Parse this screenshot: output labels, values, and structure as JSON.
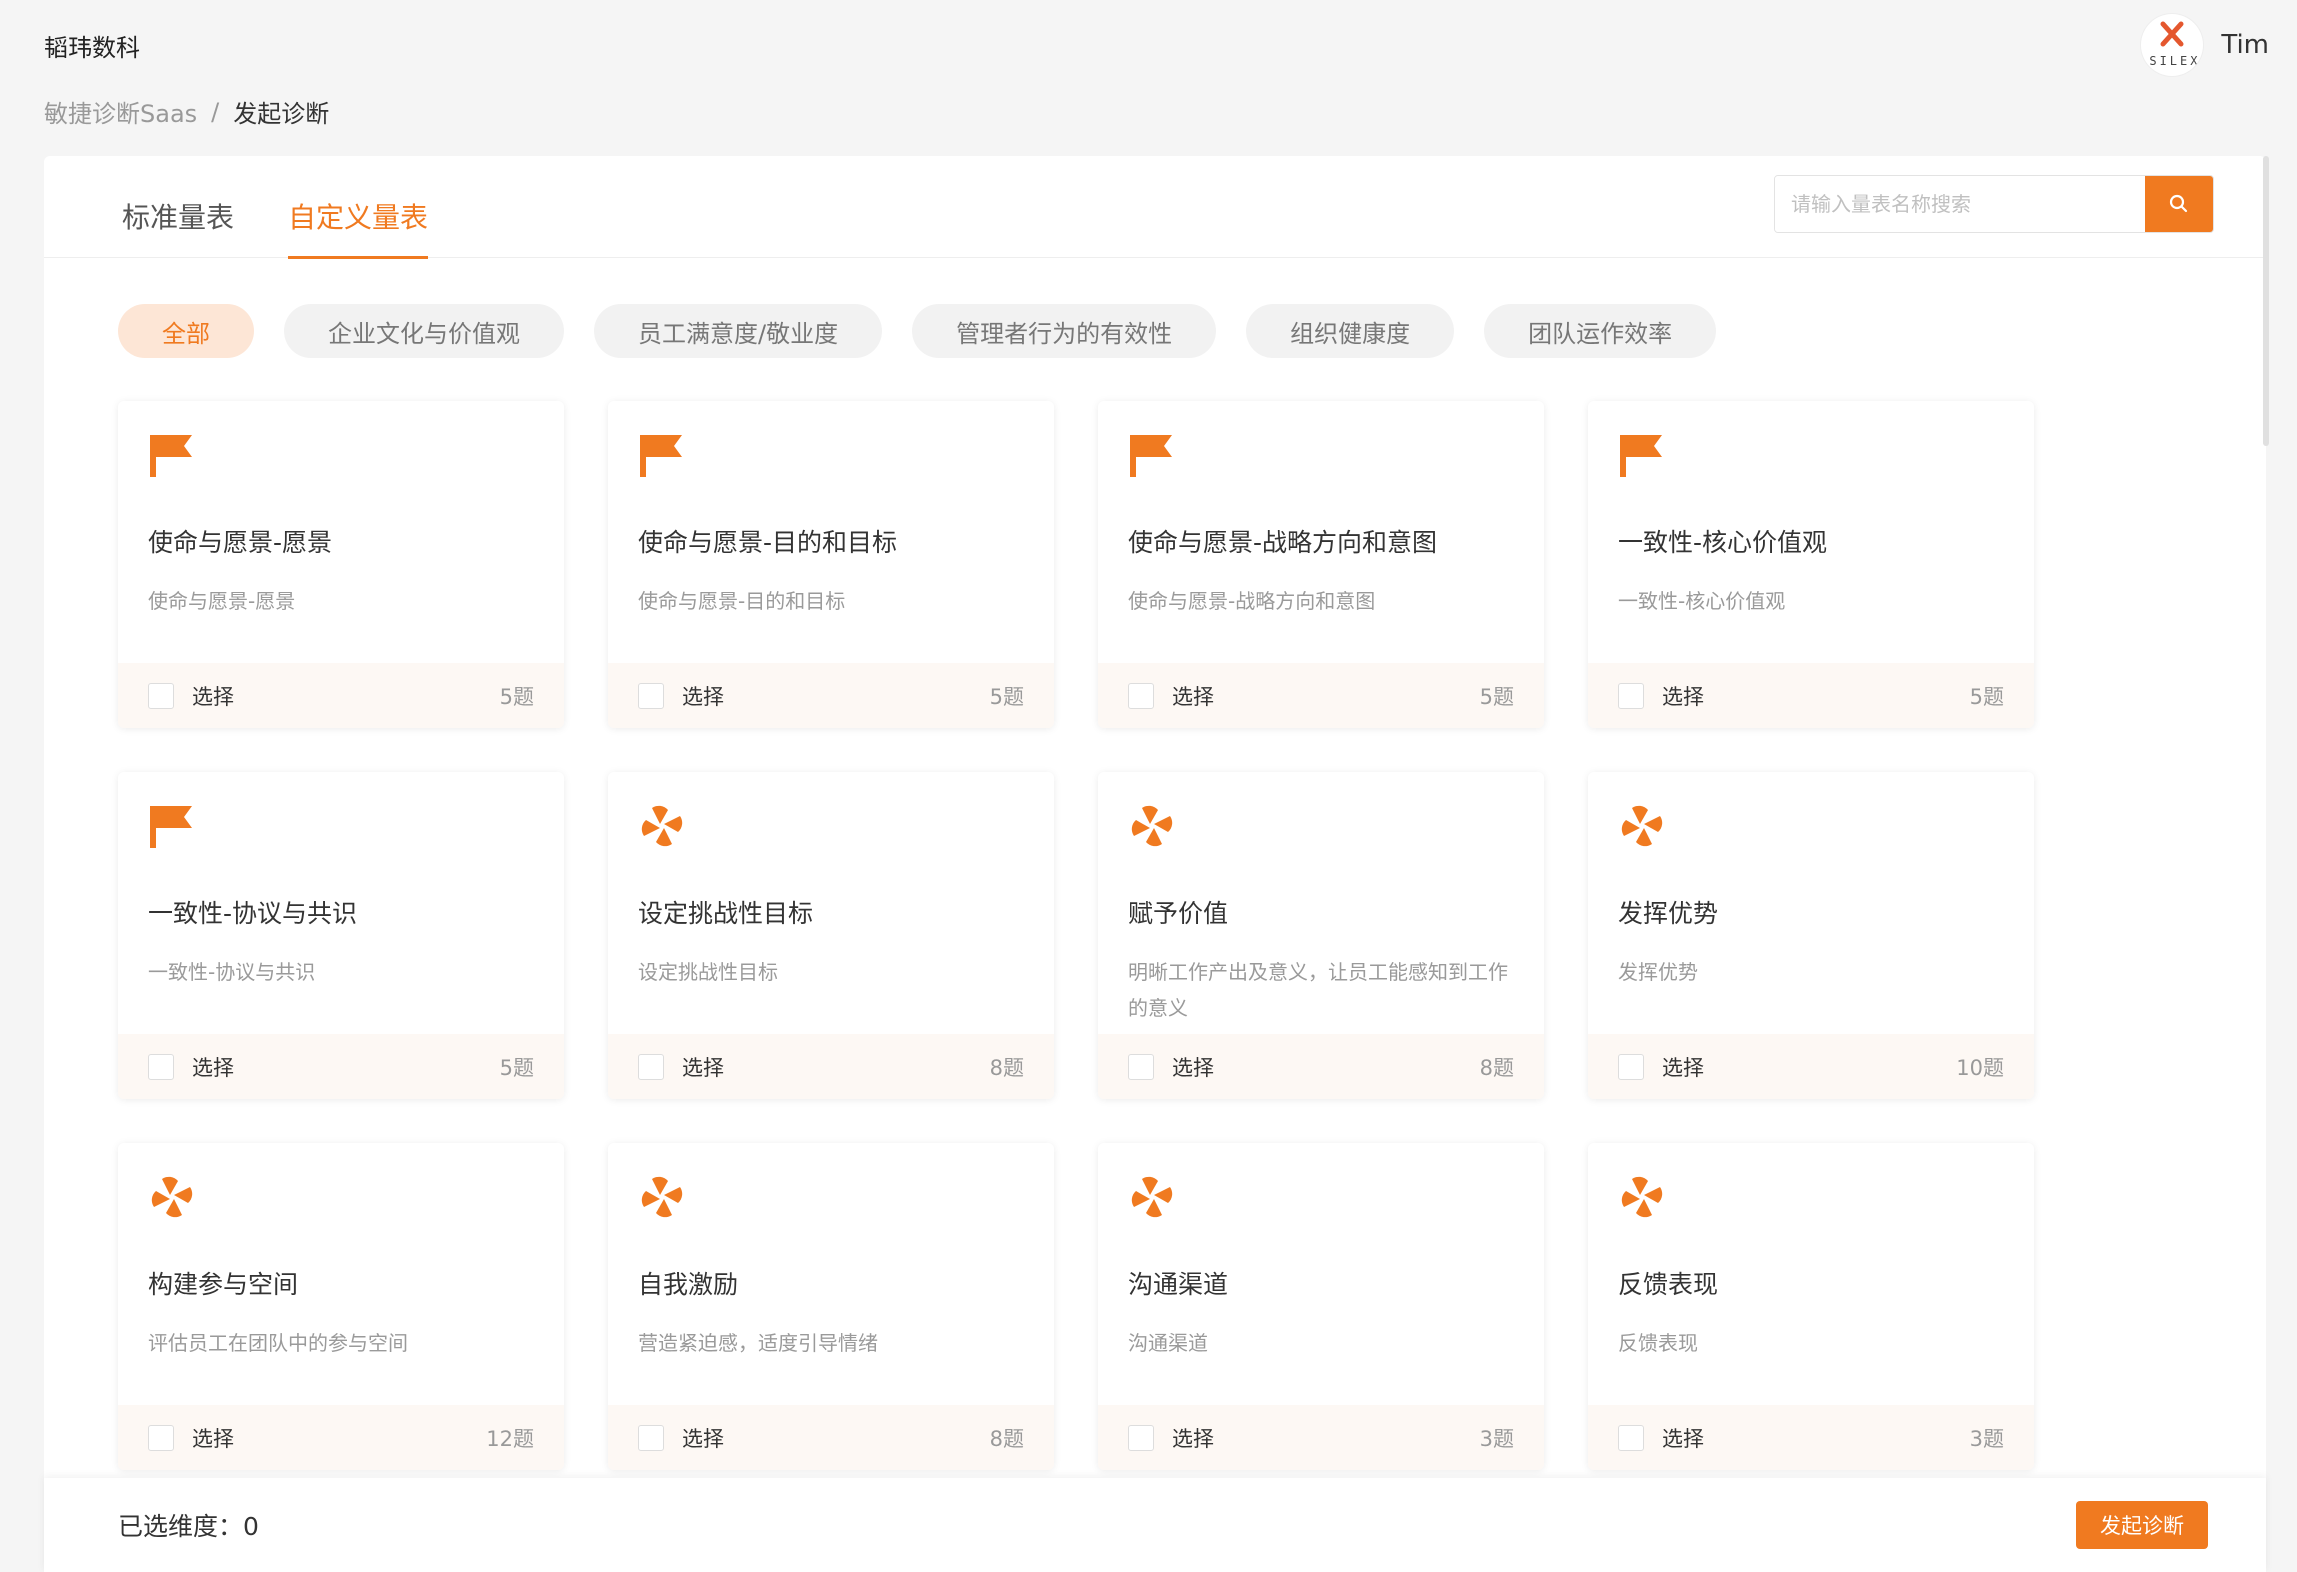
{
  "header": {
    "brand": "韬玮数科",
    "user_name": "Tim",
    "avatar_text": "SILEX"
  },
  "breadcrumb": {
    "parent": "敏捷诊断Saas",
    "separator": "/",
    "current": "发起诊断"
  },
  "tabs": [
    {
      "label": "标准量表",
      "active": false
    },
    {
      "label": "自定义量表",
      "active": true
    }
  ],
  "search": {
    "placeholder": "请输入量表名称搜索",
    "value": ""
  },
  "categories": [
    {
      "label": "全部",
      "active": true
    },
    {
      "label": "企业文化与价值观",
      "active": false
    },
    {
      "label": "员工满意度/敬业度",
      "active": false
    },
    {
      "label": "管理者行为的有效性",
      "active": false
    },
    {
      "label": "组织健康度",
      "active": false
    },
    {
      "label": "团队运作效率",
      "active": false
    }
  ],
  "select_label": "选择",
  "cards": [
    {
      "icon": "flag-icon",
      "title": "使命与愿景-愿景",
      "desc": "使命与愿景-愿景",
      "count": "5题"
    },
    {
      "icon": "flag-icon",
      "title": "使命与愿景-目的和目标",
      "desc": "使命与愿景-目的和目标",
      "count": "5题"
    },
    {
      "icon": "flag-icon",
      "title": "使命与愿景-战略方向和意图",
      "desc": "使命与愿景-战略方向和意图",
      "count": "5题"
    },
    {
      "icon": "flag-icon",
      "title": "一致性-核心价值观",
      "desc": "一致性-核心价值观",
      "count": "5题"
    },
    {
      "icon": "flag-icon",
      "title": "一致性-协议与共识",
      "desc": "一致性-协议与共识",
      "count": "5题"
    },
    {
      "icon": "pinwheel-icon",
      "title": "设定挑战性目标",
      "desc": "设定挑战性目标",
      "count": "8题"
    },
    {
      "icon": "pinwheel-icon",
      "title": "赋予价值",
      "desc": "明晰工作产出及意义，让员工能感知到工作的意义",
      "count": "8题"
    },
    {
      "icon": "pinwheel-icon",
      "title": "发挥优势",
      "desc": "发挥优势",
      "count": "10题"
    },
    {
      "icon": "pinwheel-icon",
      "title": "构建参与空间",
      "desc": "评估员工在团队中的参与空间",
      "count": "12题"
    },
    {
      "icon": "pinwheel-icon",
      "title": "自我激励",
      "desc": "营造紧迫感，适度引导情绪",
      "count": "8题"
    },
    {
      "icon": "pinwheel-icon",
      "title": "沟通渠道",
      "desc": "沟通渠道",
      "count": "3题"
    },
    {
      "icon": "pinwheel-icon",
      "title": "反馈表现",
      "desc": "反馈表现",
      "count": "3题"
    }
  ],
  "footer": {
    "selected_label": "已选维度：0",
    "launch_button": "发起诊断"
  },
  "colors": {
    "accent": "#f07a20",
    "chip_active_bg": "#fde6d6"
  }
}
